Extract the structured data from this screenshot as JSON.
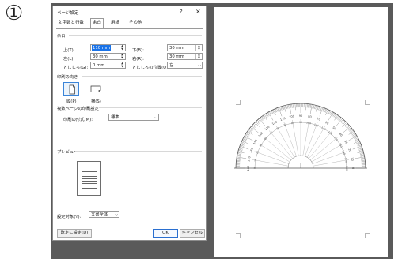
{
  "step_number": "①",
  "dialog": {
    "title": "ページ設定",
    "help": "?",
    "close": "×",
    "tabs": [
      "文字数と行数",
      "余白",
      "用紙",
      "その他"
    ],
    "active_tab": "余白",
    "margins": {
      "section": "余白",
      "top_label": "上(T):",
      "top_value": "110 mm",
      "bottom_label": "下(B):",
      "bottom_value": "30 mm",
      "left_label": "左(L):",
      "left_value": "30 mm",
      "right_label": "右(R):",
      "right_value": "30 mm",
      "gutter_label": "とじしろ(G):",
      "gutter_value": "0 mm",
      "gutter_pos_label": "とじしろの位置(U):",
      "gutter_pos_value": "左"
    },
    "orientation": {
      "section": "印刷の向き",
      "portrait": "縦(P)",
      "landscape": "横(S)",
      "selected": "portrait"
    },
    "multipage": {
      "section": "複数ページの印刷設定",
      "label": "印刷の形式(M):",
      "value": "標準"
    },
    "preview": {
      "section": "プレビュー"
    },
    "apply": {
      "label": "設定対象(Y):",
      "value": "文書全体"
    },
    "buttons": {
      "default": "既定に設定(D)",
      "ok": "OK",
      "cancel": "キャンセル"
    }
  },
  "protractor": {
    "outer_scale": [
      "0",
      "10",
      "20",
      "30",
      "40",
      "50",
      "60",
      "70",
      "80",
      "90",
      "100",
      "110",
      "120",
      "130",
      "140",
      "150",
      "160",
      "170",
      "180"
    ],
    "inner_scale": [
      "180",
      "170",
      "160",
      "150",
      "140",
      "130",
      "120",
      "110",
      "100",
      "90",
      "80",
      "70",
      "60",
      "50",
      "40",
      "30",
      "20",
      "10",
      "0"
    ]
  },
  "colors": {
    "accent": "#1a73e8",
    "workspace": "#5a5a5a",
    "selected_orient": "#3a84d8"
  }
}
